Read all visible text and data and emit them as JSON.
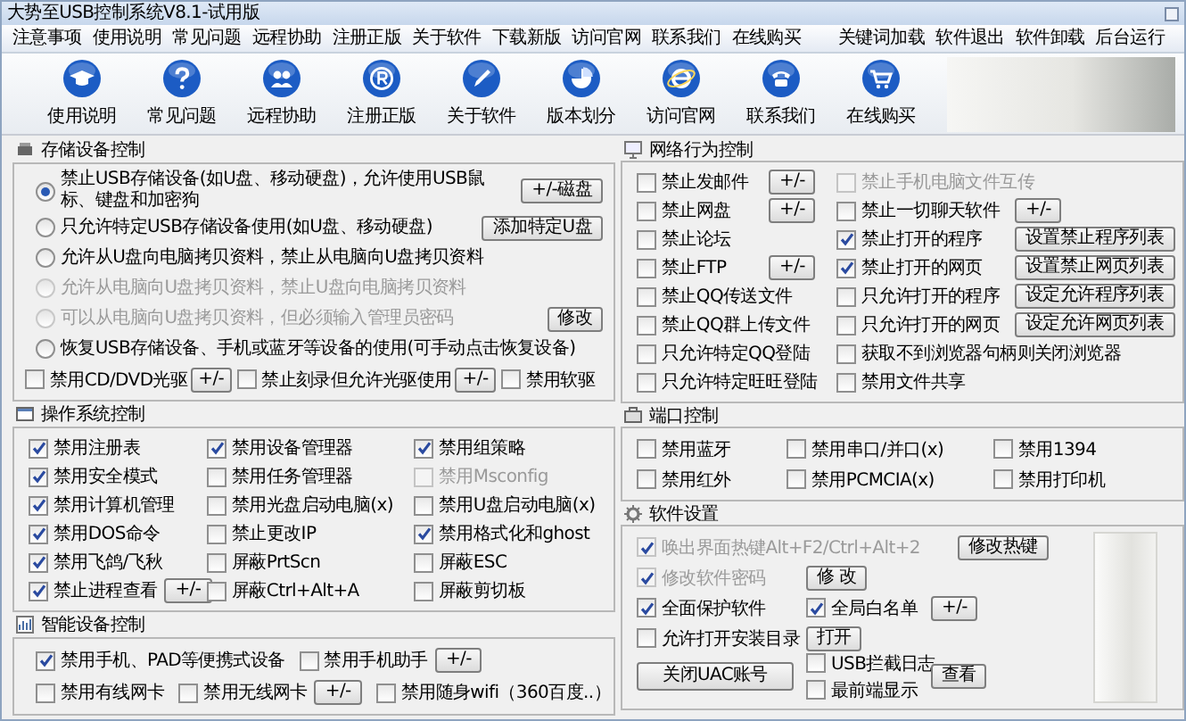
{
  "window": {
    "title": "大势至USB控制系统V8.1-试用版"
  },
  "menu": {
    "left": [
      "注意事项",
      "使用说明",
      "常见问题",
      "远程协助",
      "注册正版",
      "关于软件",
      "下载新版",
      "访问官网",
      "联系我们",
      "在线购买"
    ],
    "right": [
      "关键词加载",
      "软件退出",
      "软件卸载",
      "后台运行"
    ]
  },
  "toolbar": [
    {
      "label": "使用说明",
      "kind": "cap"
    },
    {
      "label": "常见问题",
      "kind": "question"
    },
    {
      "label": "远程协助",
      "kind": "remote"
    },
    {
      "label": "注册正版",
      "kind": "registered"
    },
    {
      "label": "关于软件",
      "kind": "pen"
    },
    {
      "label": "版本划分",
      "kind": "pie"
    },
    {
      "label": "访问官网",
      "kind": "browser"
    },
    {
      "label": "联系我们",
      "kind": "phone"
    },
    {
      "label": "在线购买",
      "kind": "cart"
    }
  ],
  "storage": {
    "title": "存储设备控制",
    "options": [
      {
        "label": "禁止USB存储设备(如U盘、移动硬盘)，允许使用USB鼠标、键盘和加密狗",
        "selected": true,
        "disabled": false,
        "button": "+/-磁盘"
      },
      {
        "label": "只允许特定USB存储设备使用(如U盘、移动硬盘)",
        "selected": false,
        "disabled": false,
        "button": "添加特定U盘"
      },
      {
        "label": "允许从U盘向电脑拷贝资料，禁止从电脑向U盘拷贝资料",
        "selected": false,
        "disabled": false
      },
      {
        "label": "允许从电脑向U盘拷贝资料，禁止U盘向电脑拷贝资料",
        "selected": false,
        "disabled": true
      },
      {
        "label": "可以从电脑向U盘拷贝资料，但必须输入管理员密码",
        "selected": false,
        "disabled": true,
        "button": "修改"
      },
      {
        "label": "恢复USB存储设备、手机或蓝牙等设备的使用(可手动点击恢复设备)",
        "selected": false,
        "disabled": false
      }
    ],
    "checks": [
      {
        "label": "禁用CD/DVD光驱",
        "checked": false,
        "button": "+/-"
      },
      {
        "label": "禁止刻录但允许光驱使用",
        "checked": false,
        "button": "+/-"
      },
      {
        "label": "禁用软驱",
        "checked": false
      }
    ]
  },
  "os": {
    "title": "操作系统控制",
    "items": [
      {
        "label": "禁用注册表",
        "checked": true,
        "disabled": false
      },
      {
        "label": "禁用设备管理器",
        "checked": true,
        "disabled": false
      },
      {
        "label": "禁用组策略",
        "checked": true,
        "disabled": false
      },
      {
        "label": "禁用安全模式",
        "checked": true,
        "disabled": false
      },
      {
        "label": "禁用任务管理器",
        "checked": false,
        "disabled": false
      },
      {
        "label": "禁用Msconfig",
        "checked": false,
        "disabled": true
      },
      {
        "label": "禁用计算机管理",
        "checked": true,
        "disabled": false
      },
      {
        "label": "禁用光盘启动电脑(x)",
        "checked": false,
        "disabled": false
      },
      {
        "label": "禁用U盘启动电脑(x)",
        "checked": false,
        "disabled": false
      },
      {
        "label": "禁用DOS命令",
        "checked": true,
        "disabled": false
      },
      {
        "label": "禁止更改IP",
        "checked": false,
        "disabled": false
      },
      {
        "label": "禁用格式化和ghost",
        "checked": true,
        "disabled": false
      },
      {
        "label": "禁用飞鸽/飞秋",
        "checked": true,
        "disabled": false
      },
      {
        "label": "屏蔽PrtScn",
        "checked": false,
        "disabled": false
      },
      {
        "label": "屏蔽ESC",
        "checked": false,
        "disabled": false
      },
      {
        "label": "禁止进程查看",
        "checked": true,
        "disabled": false,
        "button": "+/-"
      },
      {
        "label": "屏蔽Ctrl+Alt+A",
        "checked": false,
        "disabled": false
      },
      {
        "label": "屏蔽剪切板",
        "checked": false,
        "disabled": false
      }
    ]
  },
  "smart": {
    "title": "智能设备控制",
    "rows": [
      [
        {
          "label": "禁用手机、PAD等便携式设备",
          "checked": true
        },
        {
          "label": "禁用手机助手",
          "checked": false,
          "button": "+/-"
        }
      ],
      [
        {
          "label": "禁用有线网卡",
          "checked": false
        },
        {
          "label": "禁用无线网卡",
          "checked": false,
          "button": "+/-"
        },
        {
          "label": "禁用随身wifi（360百度..）",
          "checked": false
        }
      ]
    ]
  },
  "network": {
    "title": "网络行为控制",
    "rows": [
      [
        {
          "label": "禁止发邮件",
          "checked": false,
          "disabled": false,
          "button": "+/-"
        },
        {
          "label": "禁止手机电脑文件互传",
          "checked": false,
          "disabled": true
        }
      ],
      [
        {
          "label": "禁止网盘",
          "checked": false,
          "disabled": false,
          "button": "+/-"
        },
        {
          "label": "禁止一切聊天软件",
          "checked": false,
          "disabled": false,
          "button": "+/-"
        }
      ],
      [
        {
          "label": "禁止论坛",
          "checked": false,
          "disabled": false
        },
        {
          "label": "禁止打开的程序",
          "checked": true,
          "disabled": false,
          "button": "设置禁止程序列表"
        }
      ],
      [
        {
          "label": "禁止FTP",
          "checked": false,
          "disabled": false,
          "button": "+/-"
        },
        {
          "label": "禁止打开的网页",
          "checked": true,
          "disabled": false,
          "button": "设置禁止网页列表"
        }
      ],
      [
        {
          "label": "禁止QQ传送文件",
          "checked": false,
          "disabled": false
        },
        {
          "label": "只允许打开的程序",
          "checked": false,
          "disabled": false,
          "button": "设定允许程序列表"
        }
      ],
      [
        {
          "label": "禁止QQ群上传文件",
          "checked": false,
          "disabled": false
        },
        {
          "label": "只允许打开的网页",
          "checked": false,
          "disabled": false,
          "button": "设定允许网页列表"
        }
      ],
      [
        {
          "label": "只允许特定QQ登陆",
          "checked": false,
          "disabled": false
        },
        {
          "label": "获取不到浏览器句柄则关闭浏览器",
          "checked": false,
          "disabled": false
        }
      ],
      [
        {
          "label": "只允许特定旺旺登陆",
          "checked": false,
          "disabled": false
        },
        {
          "label": "禁用文件共享",
          "checked": false,
          "disabled": false
        }
      ]
    ]
  },
  "ports": {
    "title": "端口控制",
    "items": [
      {
        "label": "禁用蓝牙",
        "checked": false
      },
      {
        "label": "禁用串口/并口(x)",
        "checked": false
      },
      {
        "label": "禁用1394",
        "checked": false
      },
      {
        "label": "禁用红外",
        "checked": false
      },
      {
        "label": "禁用PCMCIA(x)",
        "checked": false
      },
      {
        "label": "禁用打印机",
        "checked": false
      }
    ]
  },
  "software": {
    "title": "软件设置",
    "hotkey": {
      "label": "唤出界面热键Alt+F2/Ctrl+Alt+2",
      "checked": true,
      "disabled": true,
      "button": "修改热键"
    },
    "password": {
      "label": "修改软件密码",
      "checked": true,
      "disabled": true,
      "button": "修 改"
    },
    "protect": {
      "label": "全面保护软件",
      "checked": true,
      "disabled": false
    },
    "whitelist": {
      "label": "全局白名单",
      "checked": true,
      "disabled": false,
      "button": "+/-"
    },
    "open_dir": {
      "label": "允许打开安装目录",
      "checked": false,
      "disabled": false,
      "button": "打开"
    },
    "uac_button": "关闭UAC账号",
    "log": {
      "label": "USB拦截日志",
      "checked": false,
      "disabled": false
    },
    "topmost": {
      "label": "最前端显示",
      "checked": false,
      "disabled": false
    },
    "view_button": "查看"
  }
}
